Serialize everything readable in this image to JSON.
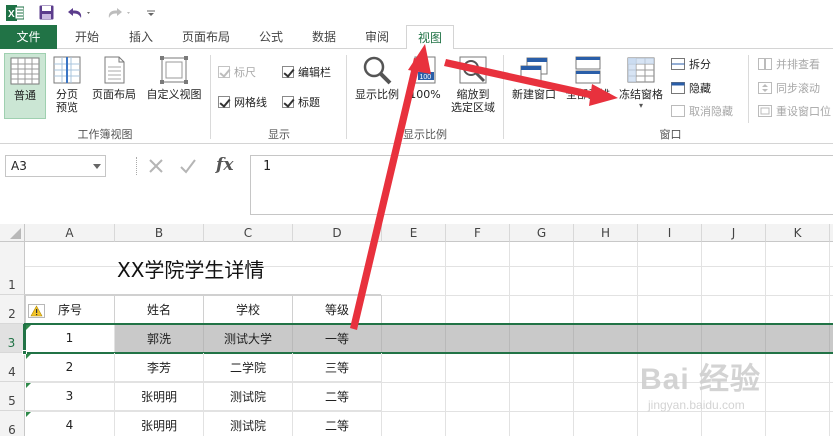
{
  "app": {
    "icon": "excel-icon"
  },
  "qat": {
    "items": [
      "excel-icon",
      "save-icon",
      "undo-icon",
      "redo-icon",
      "customize-icon"
    ]
  },
  "tabs": [
    {
      "label": "文件",
      "kind": "file"
    },
    {
      "label": "开始"
    },
    {
      "label": "插入"
    },
    {
      "label": "页面布局"
    },
    {
      "label": "公式"
    },
    {
      "label": "数据"
    },
    {
      "label": "审阅"
    },
    {
      "label": "视图",
      "active": true
    }
  ],
  "ribbon": {
    "workbook_views": {
      "group_label": "工作簿视图",
      "normal": "普通",
      "page_break_preview": "分页\n预览",
      "page_layout": "页面布局",
      "custom_view": "自定义视图"
    },
    "show": {
      "group_label": "显示",
      "ruler": "标尺",
      "formula_bar": "编辑栏",
      "gridlines": "网格线",
      "headings": "标题"
    },
    "zoom": {
      "group_label": "显示比例",
      "zoom": "显示比例",
      "zoom_100": "100%",
      "zoom_to_selection": "缩放到\n选定区域"
    },
    "window": {
      "group_label": "窗口",
      "new_window": "新建窗口",
      "arrange_all": "全部重排",
      "freeze_panes": "冻结窗格",
      "split": "拆分",
      "hide": "隐藏",
      "unhide": "取消隐藏",
      "view_side_by_side": "并排查看",
      "sync_scroll": "同步滚动",
      "reset_position": "重设窗口位"
    }
  },
  "formula_bar": {
    "name_box": "A3",
    "content": "1"
  },
  "columns": [
    "A",
    "B",
    "C",
    "D",
    "E",
    "F",
    "G",
    "H",
    "I",
    "J",
    "K"
  ],
  "rows": [
    "1",
    "2",
    "3",
    "4",
    "5",
    "6"
  ],
  "sheet": {
    "title": "XX学院学生详情",
    "header": [
      "序号",
      "姓名",
      "学校",
      "等级"
    ],
    "data": [
      [
        "1",
        "郭洗",
        "测试大学",
        "一等"
      ],
      [
        "2",
        "李芳",
        "二学院",
        "三等"
      ],
      [
        "3",
        "张明明",
        "测试院",
        "二等"
      ],
      [
        "4",
        "张明明",
        "测试院",
        "二等"
      ]
    ]
  },
  "watermark": {
    "line1": "Bai 经验",
    "line2": "jingyan.baidu.com"
  },
  "colors": {
    "excel_green": "#217346",
    "arrow_red": "#e8313d"
  }
}
